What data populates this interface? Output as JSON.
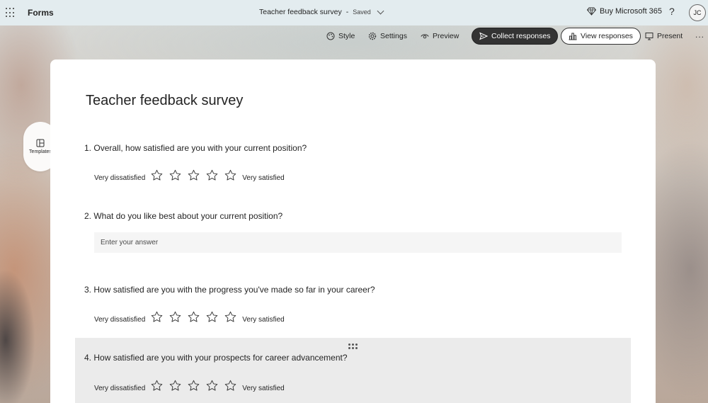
{
  "app": {
    "name": "Forms"
  },
  "document": {
    "title": "Teacher feedback survey",
    "status": "Saved"
  },
  "header": {
    "buy_label": "Buy Microsoft 365",
    "help_symbol": "?",
    "avatar_initials": "JC"
  },
  "toolbar": {
    "style": "Style",
    "settings": "Settings",
    "preview": "Preview",
    "collect": "Collect responses",
    "view": "View responses",
    "present": "Present",
    "more": "..."
  },
  "sidebar": {
    "templates": "Templates"
  },
  "form": {
    "title": "Teacher feedback survey",
    "questions": [
      {
        "number": "1.",
        "text": "Overall, how satisfied are you with your current position?",
        "type": "rating",
        "low": "Very dissatisfied",
        "high": "Very satisfied"
      },
      {
        "number": "2.",
        "text": "What do you like best about your current position?",
        "type": "text",
        "placeholder": "Enter your answer"
      },
      {
        "number": "3.",
        "text": "How satisfied are you with the progress you've made so far in your career?",
        "type": "rating",
        "low": "Very dissatisfied",
        "high": "Very satisfied"
      },
      {
        "number": "4.",
        "text": "How satisfied are you with your prospects for career advancement?",
        "type": "rating",
        "low": "Very dissatisfied",
        "high": "Very satisfied"
      }
    ]
  },
  "colors": {
    "topbar": "#e3ecef",
    "primary_button": "#333333",
    "active_question": "#ebebeb"
  }
}
